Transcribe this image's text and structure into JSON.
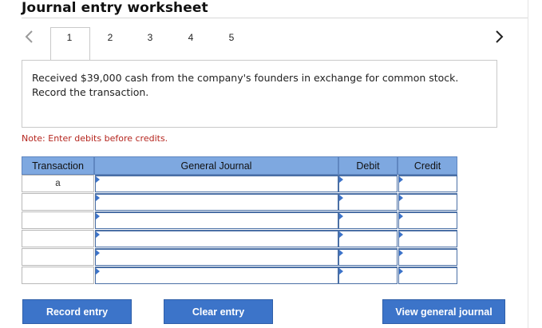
{
  "header": {
    "title": "Journal entry worksheet"
  },
  "tabs": [
    {
      "label": "1"
    },
    {
      "label": "2"
    },
    {
      "label": "3"
    },
    {
      "label": "4"
    },
    {
      "label": "5"
    }
  ],
  "active_tab": "1",
  "question": "Received $39,000 cash from the company's founders in exchange for common stock. Record the transaction.",
  "note": "Note: Enter debits before credits.",
  "table": {
    "columns": [
      "Transaction",
      "General Journal",
      "Debit",
      "Credit"
    ],
    "rows": [
      {
        "transaction": "a",
        "general_journal": "",
        "debit": "",
        "credit": ""
      },
      {
        "transaction": "",
        "general_journal": "",
        "debit": "",
        "credit": ""
      },
      {
        "transaction": "",
        "general_journal": "",
        "debit": "",
        "credit": ""
      },
      {
        "transaction": "",
        "general_journal": "",
        "debit": "",
        "credit": ""
      },
      {
        "transaction": "",
        "general_journal": "",
        "debit": "",
        "credit": ""
      },
      {
        "transaction": "",
        "general_journal": "",
        "debit": "",
        "credit": ""
      }
    ]
  },
  "buttons": {
    "record": "Record entry",
    "clear": "Clear entry",
    "view": "View general journal"
  },
  "icons": {
    "prev": "chevron-left-icon",
    "next": "chevron-right-icon"
  },
  "colors": {
    "header_bg": "#7ea8e0",
    "button_bg": "#3c74c9",
    "note_text": "#b5251e"
  }
}
